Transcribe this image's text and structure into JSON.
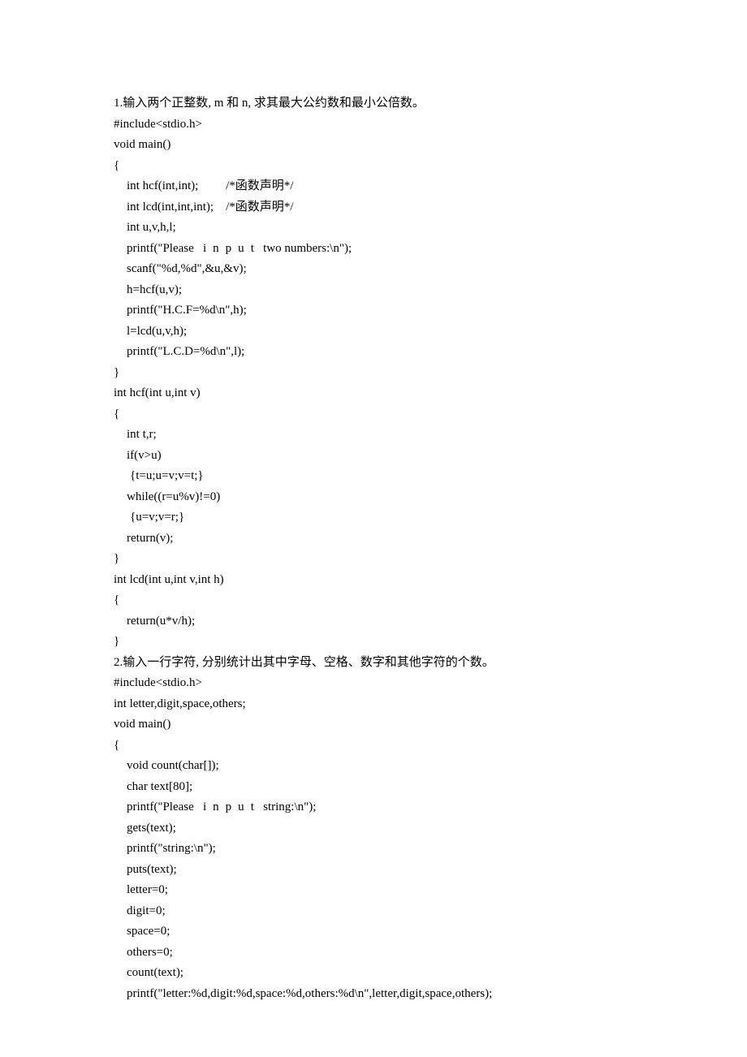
{
  "lines": [
    {
      "cls": "",
      "text": "1.输入两个正整数, m 和 n, 求其最大公约数和最小公倍数。"
    },
    {
      "cls": "",
      "text": "#include<stdio.h>"
    },
    {
      "cls": "",
      "text": "void main()"
    },
    {
      "cls": "",
      "text": "{"
    },
    {
      "cls": "indent1",
      "text": "int hcf(int,int);         /*函数声明*/"
    },
    {
      "cls": "indent1",
      "text": "int lcd(int,int,int);    /*函数声明*/"
    },
    {
      "cls": "indent1",
      "text": "int u,v,h,l;"
    },
    {
      "cls": "indent1",
      "pre": "printf(\"Please   ",
      "spaced": "inpu",
      "tail": "t   two numbers:\\n\");"
    },
    {
      "cls": "indent1",
      "text": "scanf(\"%d,%d\",&u,&v);"
    },
    {
      "cls": "indent1",
      "text": "h=hcf(u,v);"
    },
    {
      "cls": "indent1",
      "text": "printf(\"H.C.F=%d\\n\",h);"
    },
    {
      "cls": "indent1",
      "text": "l=lcd(u,v,h);"
    },
    {
      "cls": "indent1",
      "text": "printf(\"L.C.D=%d\\n\",l);"
    },
    {
      "cls": "",
      "text": "}"
    },
    {
      "cls": "",
      "text": "int hcf(int u,int v)"
    },
    {
      "cls": "",
      "text": "{"
    },
    {
      "cls": "indent1",
      "text": "int t,r;"
    },
    {
      "cls": "indent1",
      "text": "if(v>u)"
    },
    {
      "cls": "indent2",
      "text": "{t=u;u=v;v=t;}"
    },
    {
      "cls": "indent1",
      "text": "while((r=u%v)!=0)"
    },
    {
      "cls": "indent2",
      "text": "{u=v;v=r;}"
    },
    {
      "cls": "indent1",
      "text": "return(v);"
    },
    {
      "cls": "",
      "text": "}"
    },
    {
      "cls": "",
      "text": "int lcd(int u,int v,int h)"
    },
    {
      "cls": "",
      "text": "{"
    },
    {
      "cls": "indent1",
      "text": "return(u*v/h);"
    },
    {
      "cls": "",
      "text": "}"
    },
    {
      "cls": "",
      "text": "2.输入一行字符, 分别统计出其中字母、空格、数字和其他字符的个数。"
    },
    {
      "cls": "",
      "text": "#include<stdio.h>"
    },
    {
      "cls": "",
      "text": "int letter,digit,space,others;"
    },
    {
      "cls": "",
      "text": "void main()"
    },
    {
      "cls": "",
      "text": "{"
    },
    {
      "cls": "indent1",
      "text": "void count(char[]);"
    },
    {
      "cls": "indent1",
      "text": "char text[80];"
    },
    {
      "cls": "indent1",
      "pre": "printf(\"Please   ",
      "spaced": "inpu",
      "tail": "t   string:\\n\");"
    },
    {
      "cls": "indent1",
      "text": "gets(text);"
    },
    {
      "cls": "indent1",
      "text": "printf(\"string:\\n\");"
    },
    {
      "cls": "indent1",
      "text": "puts(text);"
    },
    {
      "cls": "indent1",
      "text": "letter=0;"
    },
    {
      "cls": "indent1",
      "text": "digit=0;"
    },
    {
      "cls": "indent1",
      "text": "space=0;"
    },
    {
      "cls": "indent1",
      "text": "others=0;"
    },
    {
      "cls": "indent1",
      "text": "count(text);"
    },
    {
      "cls": "indent1",
      "text": "printf(\"letter:%d,digit:%d,space:%d,others:%d\\n\",letter,digit,space,others);"
    }
  ]
}
